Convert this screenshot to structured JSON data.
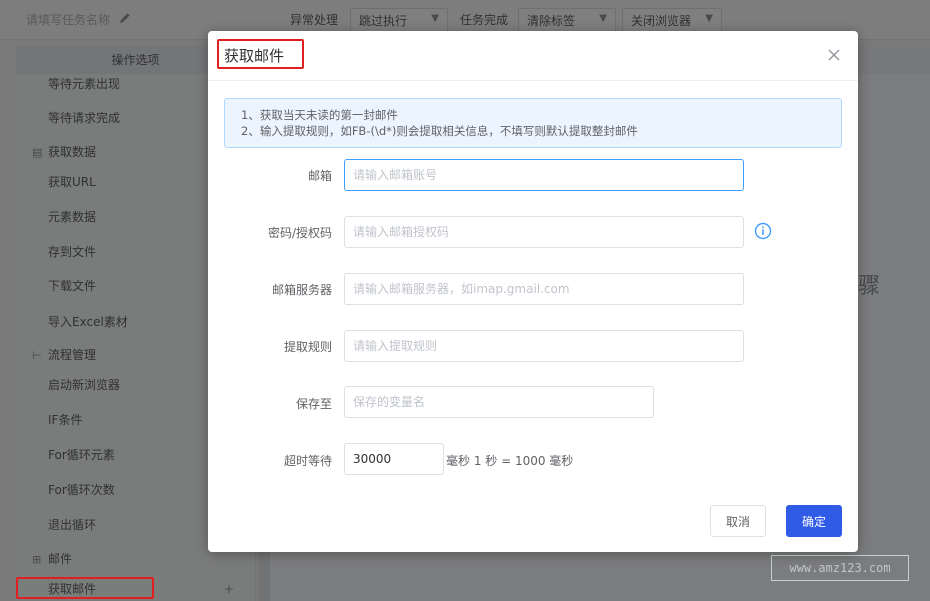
{
  "topbar": {
    "task_name": "请填写任务名称",
    "exception_label": "异常处理",
    "exception_value": "跳过执行",
    "complete_label": "任务完成",
    "complete_value": "清除标签",
    "browser_value": "关闭浏览器"
  },
  "sidebar": {
    "header": "操作选项",
    "items": [
      {
        "label": "等待元素出现",
        "kind": "item"
      },
      {
        "label": "等待请求完成",
        "kind": "item"
      },
      {
        "label": "获取数据",
        "kind": "group"
      },
      {
        "label": "获取URL",
        "kind": "item"
      },
      {
        "label": "元素数据",
        "kind": "item"
      },
      {
        "label": "存到文件",
        "kind": "item"
      },
      {
        "label": "下载文件",
        "kind": "item"
      },
      {
        "label": "导入Excel素材",
        "kind": "item"
      },
      {
        "label": "流程管理",
        "kind": "group"
      },
      {
        "label": "启动新浏览器",
        "kind": "item"
      },
      {
        "label": "IF条件",
        "kind": "item"
      },
      {
        "label": "For循环元素",
        "kind": "item"
      },
      {
        "label": "For循环次数",
        "kind": "item"
      },
      {
        "label": "退出循环",
        "kind": "item"
      },
      {
        "label": "邮件",
        "kind": "group"
      },
      {
        "label": "获取邮件",
        "kind": "item"
      }
    ],
    "plus": "+"
  },
  "canvas": {
    "partial_text": "骤"
  },
  "watermark": "www.amz123.com",
  "dialog": {
    "title": "获取邮件",
    "tip_line1": "1、获取当天未读的第一封邮件",
    "tip_line2": "2、输入提取规则，如FB-(\\d*)则会提取相关信息，不填写则默认提取整封邮件",
    "fields": {
      "email": {
        "label": "邮箱",
        "placeholder": "请输入邮箱账号"
      },
      "password": {
        "label": "密码/授权码",
        "placeholder": "请输入邮箱授权码"
      },
      "server": {
        "label": "邮箱服务器",
        "placeholder": "请输入邮箱服务器，如imap.gmail.com"
      },
      "rule": {
        "label": "提取规则",
        "placeholder": "请输入提取规则"
      },
      "save_to": {
        "label": "保存至",
        "placeholder": "保存的变量名"
      },
      "timeout": {
        "label": "超时等待",
        "value": "30000",
        "unit": "毫秒 1 秒 = 1000 毫秒"
      }
    },
    "cancel_label": "取消",
    "ok_label": "确定"
  },
  "colors": {
    "primary": "#2f5be7",
    "highlight": "#e02020",
    "info": "#409eff"
  }
}
